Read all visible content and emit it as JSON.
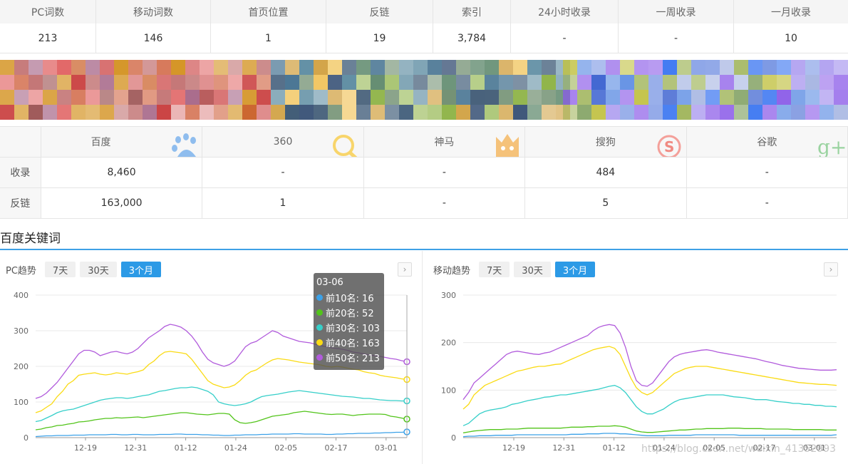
{
  "stats": {
    "headers": [
      "PC词数",
      "移动词数",
      "首页位置",
      "反链",
      "索引",
      "24小时收录",
      "一周收录",
      "一月收录"
    ],
    "values": [
      "213",
      "146",
      "1",
      "19",
      "3,784",
      "-",
      "-",
      "10"
    ]
  },
  "engines": {
    "headers": [
      "百度",
      "360",
      "神马",
      "搜狗",
      "谷歌"
    ],
    "logo_icons": [
      "baidu-paw-icon",
      "360-search-icon",
      "shenma-icon",
      "sogou-icon",
      "google-plus-icon"
    ],
    "rows": [
      {
        "label": "收录",
        "values": [
          "8,460",
          "-",
          "-",
          "484",
          "-"
        ]
      },
      {
        "label": "反链",
        "values": [
          "163,000",
          "1",
          "-",
          "5",
          "-"
        ]
      }
    ]
  },
  "section_title": "百度关键词",
  "pc_panel": {
    "label": "PC趋势",
    "tabs": [
      "7天",
      "30天",
      "3个月"
    ],
    "active_tab": 2
  },
  "mobile_panel": {
    "label": "移动趋势",
    "tabs": [
      "7天",
      "30天",
      "3个月"
    ],
    "active_tab": 2
  },
  "tooltip": {
    "title": "03-06",
    "rows": [
      {
        "label": "前10名: 16",
        "color": "#3ba1e8"
      },
      {
        "label": "前20名: 52",
        "color": "#52c41a"
      },
      {
        "label": "前30名: 103",
        "color": "#36cfc9"
      },
      {
        "label": "前40名: 163",
        "color": "#fadb14"
      },
      {
        "label": "前50名: 213",
        "color": "#b15bdc"
      }
    ]
  },
  "watermark": "https://blog.csdn.net/weixin_41352993",
  "chart_data": [
    {
      "type": "line",
      "name": "PC趋势",
      "ylim": [
        0,
        400
      ],
      "yticks": [
        0,
        100,
        200,
        300,
        400
      ],
      "xtick_labels": [
        "12-19",
        "12-31",
        "01-12",
        "01-24",
        "02-05",
        "02-17",
        "03-01"
      ],
      "series": [
        {
          "name": "前10名",
          "color": "#3ba1e8",
          "values": [
            3,
            4,
            5,
            5,
            6,
            6,
            6,
            7,
            7,
            7,
            8,
            8,
            8,
            8,
            9,
            9,
            8,
            8,
            9,
            9,
            8,
            8,
            8,
            9,
            9,
            9,
            10,
            10,
            9,
            9,
            9,
            8,
            8,
            7,
            7,
            6,
            6,
            7,
            7,
            8,
            8,
            8,
            9,
            9,
            10,
            10,
            10,
            10,
            11,
            11,
            10,
            10,
            10,
            10,
            9,
            9,
            10,
            10,
            11,
            11,
            12,
            12,
            12,
            13,
            13,
            14,
            14,
            15,
            15,
            16
          ]
        },
        {
          "name": "前20名",
          "color": "#52c41a",
          "values": [
            22,
            24,
            28,
            30,
            34,
            35,
            38,
            40,
            44,
            45,
            47,
            50,
            52,
            54,
            54,
            56,
            55,
            56,
            57,
            58,
            56,
            58,
            60,
            62,
            64,
            66,
            68,
            70,
            70,
            68,
            66,
            65,
            64,
            66,
            68,
            68,
            66,
            50,
            42,
            40,
            42,
            45,
            50,
            55,
            60,
            62,
            64,
            66,
            70,
            72,
            74,
            72,
            70,
            68,
            66,
            65,
            66,
            66,
            64,
            62,
            64,
            65,
            66,
            66,
            66,
            65,
            60,
            58,
            55,
            52
          ]
        },
        {
          "name": "前30名",
          "color": "#36cfc9",
          "values": [
            45,
            48,
            55,
            62,
            70,
            75,
            78,
            80,
            85,
            90,
            95,
            100,
            105,
            108,
            110,
            112,
            112,
            110,
            112,
            115,
            118,
            120,
            125,
            130,
            132,
            135,
            138,
            140,
            140,
            142,
            140,
            135,
            130,
            120,
            100,
            95,
            92,
            90,
            92,
            95,
            100,
            108,
            115,
            118,
            120,
            122,
            125,
            128,
            130,
            132,
            130,
            128,
            126,
            124,
            122,
            120,
            118,
            116,
            115,
            114,
            112,
            110,
            110,
            108,
            106,
            105,
            104,
            104,
            103,
            103
          ]
        },
        {
          "name": "前40名",
          "color": "#fadb14",
          "values": [
            70,
            75,
            85,
            95,
            115,
            130,
            150,
            160,
            175,
            178,
            180,
            182,
            178,
            176,
            178,
            182,
            180,
            178,
            182,
            185,
            190,
            205,
            215,
            230,
            240,
            242,
            240,
            238,
            235,
            220,
            200,
            180,
            160,
            150,
            145,
            140,
            142,
            148,
            160,
            175,
            185,
            190,
            200,
            210,
            218,
            222,
            220,
            218,
            215,
            212,
            210,
            208,
            206,
            204,
            200,
            198,
            200,
            198,
            195,
            192,
            190,
            185,
            182,
            180,
            175,
            172,
            170,
            168,
            165,
            163
          ]
        },
        {
          "name": "前50名",
          "color": "#b15bdc",
          "values": [
            110,
            115,
            125,
            140,
            155,
            175,
            195,
            215,
            235,
            245,
            245,
            240,
            230,
            235,
            240,
            242,
            238,
            235,
            240,
            250,
            265,
            280,
            290,
            300,
            312,
            318,
            315,
            310,
            300,
            285,
            265,
            240,
            220,
            210,
            205,
            200,
            205,
            215,
            235,
            255,
            265,
            270,
            280,
            290,
            300,
            295,
            285,
            280,
            275,
            270,
            268,
            266,
            262,
            258,
            255,
            252,
            250,
            248,
            245,
            240,
            238,
            235,
            232,
            230,
            228,
            225,
            222,
            220,
            216,
            213
          ]
        }
      ]
    },
    {
      "type": "line",
      "name": "移动趋势",
      "ylim": [
        0,
        300
      ],
      "yticks": [
        0,
        100,
        200,
        300
      ],
      "xtick_labels": [
        "12-19",
        "12-31",
        "01-12",
        "01-24",
        "02-05",
        "02-17",
        "03-01"
      ],
      "series": [
        {
          "name": "前10名",
          "color": "#3ba1e8",
          "values": [
            2,
            3,
            3,
            4,
            4,
            4,
            5,
            5,
            5,
            5,
            6,
            6,
            6,
            6,
            6,
            6,
            6,
            6,
            6,
            6,
            7,
            7,
            7,
            8,
            8,
            8,
            9,
            9,
            9,
            8,
            8,
            7,
            6,
            5,
            4,
            4,
            4,
            4,
            5,
            5,
            5,
            5,
            5,
            6,
            6,
            6,
            6,
            6,
            6,
            6,
            6,
            5,
            5,
            5,
            5,
            5,
            5,
            5,
            5,
            5,
            5,
            5,
            5,
            5,
            5,
            5,
            5,
            5,
            5,
            6
          ]
        },
        {
          "name": "前20名",
          "color": "#52c41a",
          "values": [
            10,
            12,
            14,
            15,
            16,
            17,
            17,
            17,
            18,
            18,
            18,
            19,
            20,
            20,
            20,
            20,
            20,
            20,
            20,
            21,
            22,
            22,
            22,
            23,
            23,
            24,
            24,
            24,
            25,
            24,
            22,
            18,
            14,
            12,
            11,
            11,
            12,
            13,
            14,
            15,
            16,
            16,
            17,
            18,
            18,
            19,
            19,
            19,
            19,
            20,
            20,
            20,
            19,
            19,
            19,
            19,
            18,
            18,
            18,
            18,
            18,
            17,
            17,
            17,
            17,
            17,
            17,
            16,
            16,
            16
          ]
        },
        {
          "name": "前30名",
          "color": "#36cfc9",
          "values": [
            25,
            30,
            40,
            50,
            55,
            58,
            60,
            62,
            65,
            70,
            72,
            75,
            78,
            80,
            82,
            85,
            86,
            88,
            90,
            90,
            92,
            94,
            96,
            98,
            100,
            102,
            105,
            108,
            110,
            105,
            95,
            80,
            65,
            55,
            50,
            50,
            55,
            60,
            68,
            75,
            80,
            82,
            84,
            86,
            88,
            90,
            90,
            90,
            90,
            88,
            86,
            85,
            84,
            82,
            80,
            80,
            80,
            78,
            76,
            75,
            74,
            72,
            72,
            70,
            70,
            68,
            68,
            66,
            66,
            65
          ]
        },
        {
          "name": "前40名",
          "color": "#fadb14",
          "values": [
            60,
            70,
            90,
            100,
            110,
            115,
            120,
            125,
            130,
            135,
            140,
            142,
            145,
            148,
            150,
            150,
            152,
            154,
            155,
            160,
            165,
            170,
            175,
            180,
            185,
            188,
            190,
            192,
            188,
            175,
            150,
            125,
            105,
            95,
            90,
            95,
            105,
            115,
            125,
            135,
            140,
            145,
            148,
            150,
            150,
            150,
            148,
            146,
            144,
            142,
            140,
            138,
            136,
            134,
            132,
            130,
            128,
            126,
            124,
            122,
            120,
            118,
            116,
            115,
            114,
            113,
            112,
            112,
            111,
            110
          ]
        },
        {
          "name": "前50名",
          "color": "#b15bdc",
          "values": [
            80,
            95,
            115,
            125,
            135,
            145,
            155,
            165,
            175,
            180,
            182,
            180,
            178,
            176,
            175,
            178,
            180,
            185,
            190,
            195,
            200,
            205,
            210,
            215,
            225,
            232,
            236,
            238,
            236,
            220,
            190,
            150,
            120,
            110,
            108,
            115,
            130,
            145,
            160,
            170,
            175,
            178,
            180,
            182,
            184,
            185,
            183,
            180,
            178,
            176,
            174,
            172,
            170,
            168,
            166,
            163,
            160,
            158,
            155,
            152,
            150,
            148,
            146,
            145,
            144,
            143,
            142,
            142,
            142,
            143
          ]
        }
      ]
    }
  ]
}
